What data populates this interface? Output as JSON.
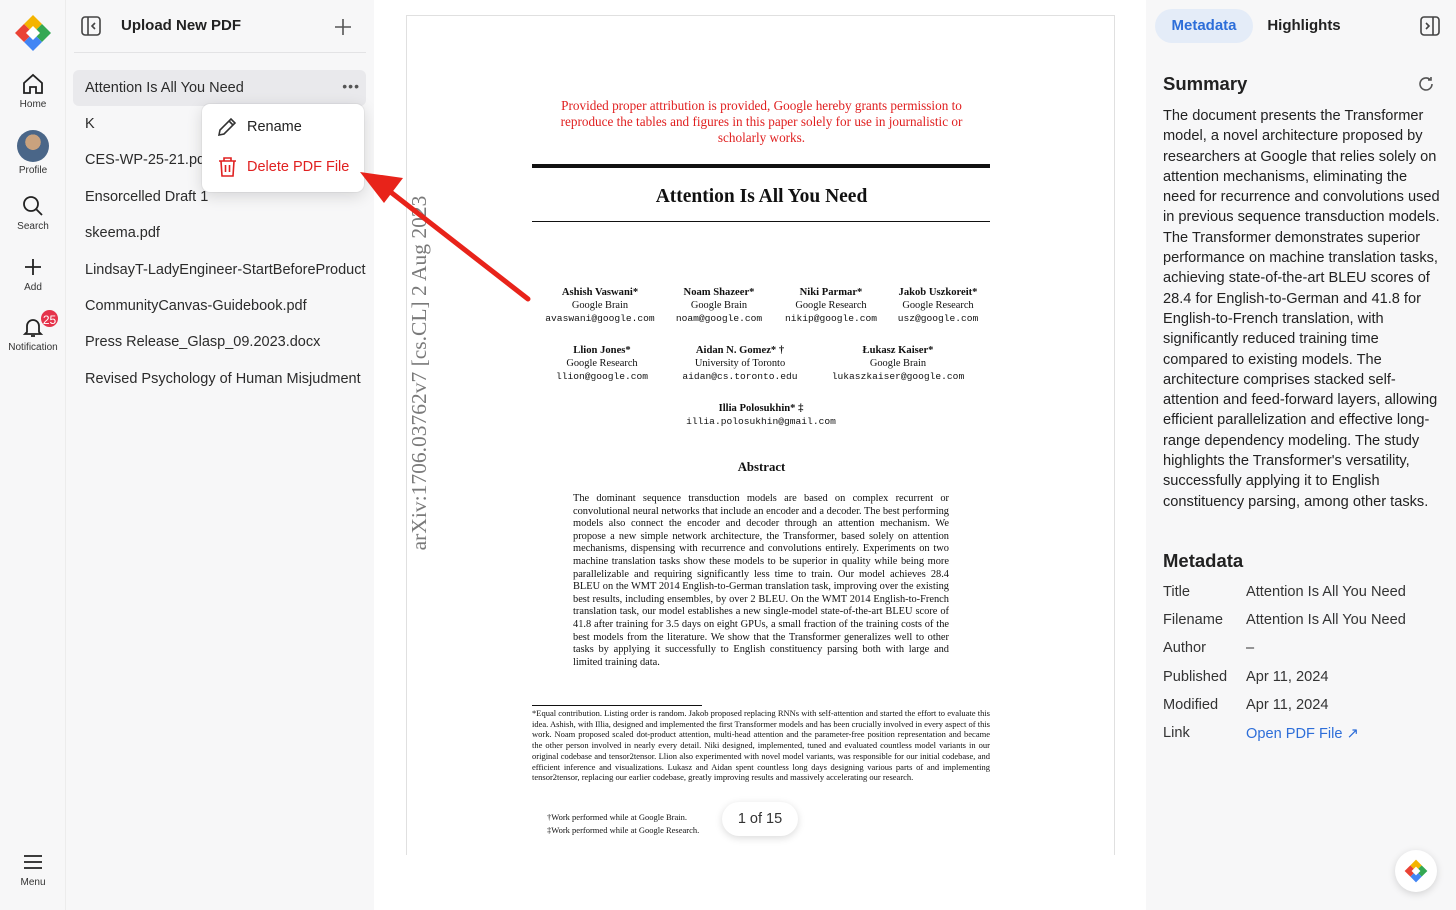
{
  "rail": {
    "items": [
      {
        "label": "Home",
        "icon": "home-icon"
      },
      {
        "label": "Profile",
        "icon": "avatar"
      },
      {
        "label": "Search",
        "icon": "search-icon"
      },
      {
        "label": "Add",
        "icon": "plus-icon"
      },
      {
        "label": "Notification",
        "icon": "bell-icon",
        "badge": "25"
      },
      {
        "label": "Menu",
        "icon": "hamburger-icon"
      }
    ]
  },
  "files": {
    "header_title": "Upload New PDF",
    "items": [
      "Attention Is All You Need",
      "K",
      "CES-WP-25-21.pdf",
      "Ensorcelled Draft 1",
      "skeema.pdf",
      "LindsayT-LadyEngineer-StartBeforeProduct",
      "CommunityCanvas-Guidebook.pdf",
      "Press Release_Glasp_09.2023.docx",
      "Revised Psychology of Human Misjudment"
    ],
    "active_index": 0,
    "context_menu": {
      "rename": "Rename",
      "delete": "Delete PDF File"
    }
  },
  "pdf": {
    "permission": "Provided proper attribution is provided, Google hereby grants permission to reproduce the tables and figures in this paper solely for use in journalistic or scholarly works.",
    "title": "Attention Is All You Need",
    "authors": [
      {
        "name": "Ashish Vaswani*",
        "org": "Google Brain",
        "email": "avaswani@google.com"
      },
      {
        "name": "Noam Shazeer*",
        "org": "Google Brain",
        "email": "noam@google.com"
      },
      {
        "name": "Niki Parmar*",
        "org": "Google Research",
        "email": "nikip@google.com"
      },
      {
        "name": "Jakob Uszkoreit*",
        "org": "Google Research",
        "email": "usz@google.com"
      },
      {
        "name": "Llion Jones*",
        "org": "Google Research",
        "email": "llion@google.com"
      },
      {
        "name": "Aidan N. Gomez* †",
        "org": "University of Toronto",
        "email": "aidan@cs.toronto.edu"
      },
      {
        "name": "Łukasz Kaiser*",
        "org": "Google Brain",
        "email": "lukaszkaiser@google.com"
      },
      {
        "name": "Illia Polosukhin* ‡",
        "org": "",
        "email": "illia.polosukhin@gmail.com"
      }
    ],
    "abstract_heading": "Abstract",
    "abstract": "The dominant sequence transduction models are based on complex recurrent or convolutional neural networks that include an encoder and a decoder. The best performing models also connect the encoder and decoder through an attention mechanism. We propose a new simple network architecture, the Transformer, based solely on attention mechanisms, dispensing with recurrence and convolutions entirely. Experiments on two machine translation tasks show these models to be superior in quality while being more parallelizable and requiring significantly less time to train. Our model achieves 28.4 BLEU on the WMT 2014 English-to-German translation task, improving over the existing best results, including ensembles, by over 2 BLEU. On the WMT 2014 English-to-French translation task, our model establishes a new single-model state-of-the-art BLEU score of 41.8 after training for 3.5 days on eight GPUs, a small fraction of the training costs of the best models from the literature. We show that the Transformer generalizes well to other tasks by applying it successfully to English constituency parsing both with large and limited training data.",
    "footnote": "*Equal contribution. Listing order is random. Jakob proposed replacing RNNs with self-attention and started the effort to evaluate this idea. Ashish, with Illia, designed and implemented the first Transformer models and has been crucially involved in every aspect of this work. Noam proposed scaled dot-product attention, multi-head attention and the parameter-free position representation and became the other person involved in nearly every detail. Niki designed, implemented, tuned and evaluated countless model variants in our original codebase and tensor2tensor. Llion also experimented with novel model variants, was responsible for our initial codebase, and efficient inference and visualizations. Lukasz and Aidan spent countless long days designing various parts of and implementing tensor2tensor, replacing our earlier codebase, greatly improving results and massively accelerating our research.",
    "footnote_dagger": "†Work performed while at Google Brain.",
    "footnote_ddagger": "‡Work performed while at Google Research.",
    "arxiv_stamp": "arXiv:1706.03762v7  [cs.CL]  2 Aug 2023",
    "page_indicator": "1 of 15"
  },
  "right_panel": {
    "tabs": [
      "Metadata",
      "Highlights"
    ],
    "active_tab": "Metadata",
    "summary_heading": "Summary",
    "summary": "The document presents the Transformer model, a novel architecture proposed by researchers at Google that relies solely on attention mechanisms, eliminating the need for recurrence and convolutions used in previous sequence transduction models. The Transformer demonstrates superior performance on machine translation tasks, achieving state-of-the-art BLEU scores of 28.4 for English-to-German and 41.8 for English-to-French translation, with significantly reduced training time compared to existing models. The architecture comprises stacked self-attention and feed-forward layers, allowing efficient parallelization and effective long-range dependency modeling. The study highlights the Transformer's versatility, successfully applying it to English constituency parsing, among other tasks.",
    "metadata_heading": "Metadata",
    "metadata": [
      {
        "key": "Title",
        "value": "Attention Is All You Need"
      },
      {
        "key": "Filename",
        "value": "Attention Is All You Need"
      },
      {
        "key": "Author",
        "value": "–"
      },
      {
        "key": "Published",
        "value": "Apr 11, 2024"
      },
      {
        "key": "Modified",
        "value": "Apr 11, 2024"
      },
      {
        "key": "Link",
        "value": "Open PDF File ↗"
      }
    ]
  },
  "colors": {
    "accent": "#2d6ed9",
    "danger": "#e02020",
    "annotation_arrow": "#e8231a"
  }
}
